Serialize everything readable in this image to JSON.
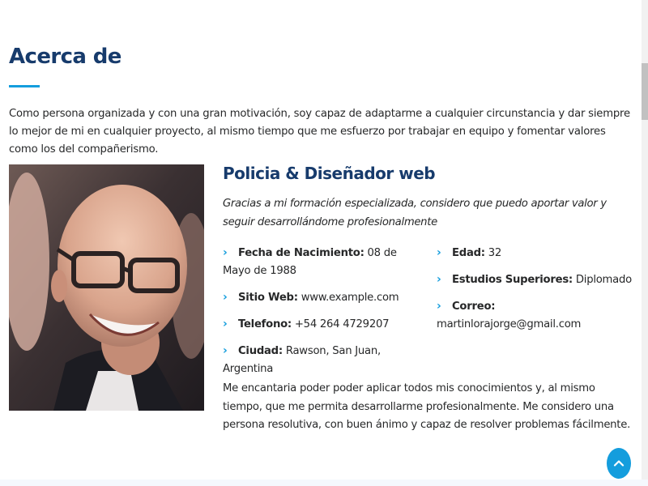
{
  "section": {
    "title": "Acerca de",
    "intro": "Como persona organizada y con una gran motivación, soy capaz de adaptarme a cualquier circunstancia y dar siempre lo mejor de mi en cualquier proyecto, al mismo tiempo que me esfuerzo por trabajar en equipo y fomentar valores como los del compañerismo."
  },
  "profile": {
    "role": "Policia & Diseñador web",
    "tagline": "Gracias a mi formación especializada, considero que puedo aportar valor y seguir desarrollándome profesionalmente",
    "details_left": [
      {
        "label": "Fecha de Nacimiento:",
        "value": "08 de Mayo de 1988"
      },
      {
        "label": "Sitio Web:",
        "value": "www.example.com"
      },
      {
        "label": "Telefono:",
        "value": "+54 264 4729207"
      },
      {
        "label": "Ciudad:",
        "value": "Rawson, San Juan, Argentina"
      }
    ],
    "details_right": [
      {
        "label": "Edad:",
        "value": "32"
      },
      {
        "label": "Estudios Superiores:",
        "value": "Diplomado"
      },
      {
        "label": "Correo:",
        "value": "martinlorajorge@gmail.com"
      }
    ],
    "outro": "Me encantaria poder poder aplicar todos mis conocimientos y, al mismo tiempo, que me permita desarrollarme profesionalmente. Me considero una persona resolutiva, con buen ánimo y capaz de resolver problemas fácilmente."
  },
  "icons": {
    "bullet": "chevron-right-icon",
    "back_to_top": "chevron-up-icon"
  },
  "colors": {
    "heading": "#173b6c",
    "accent": "#149ddd",
    "text": "#272829"
  }
}
